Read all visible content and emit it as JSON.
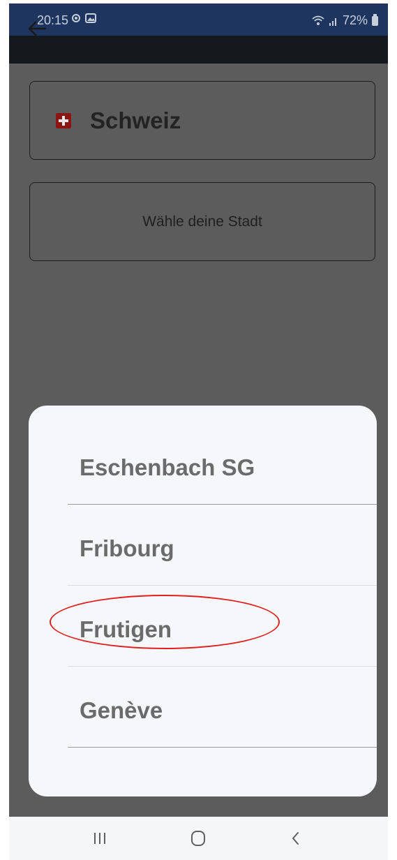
{
  "status_bar": {
    "time": "20:15",
    "battery": "72%",
    "background_color": "#1e3560"
  },
  "app_bar": {
    "back_icon": "arrow-left-icon"
  },
  "country_selector": {
    "label": "Schweiz",
    "flag_icon": "swiss-flag-icon"
  },
  "city_selector": {
    "placeholder": "Wähle deine Stadt"
  },
  "city_sheet": {
    "items": [
      {
        "label": "Eschenbach SG"
      },
      {
        "label": "Fribourg"
      },
      {
        "label": "Frutigen",
        "highlighted": true
      },
      {
        "label": "Genève"
      }
    ],
    "annotation_color": "#e0201f"
  },
  "nav_bar": {
    "recent_icon": "recent-apps-icon",
    "home_icon": "home-icon",
    "back_icon": "back-icon"
  }
}
